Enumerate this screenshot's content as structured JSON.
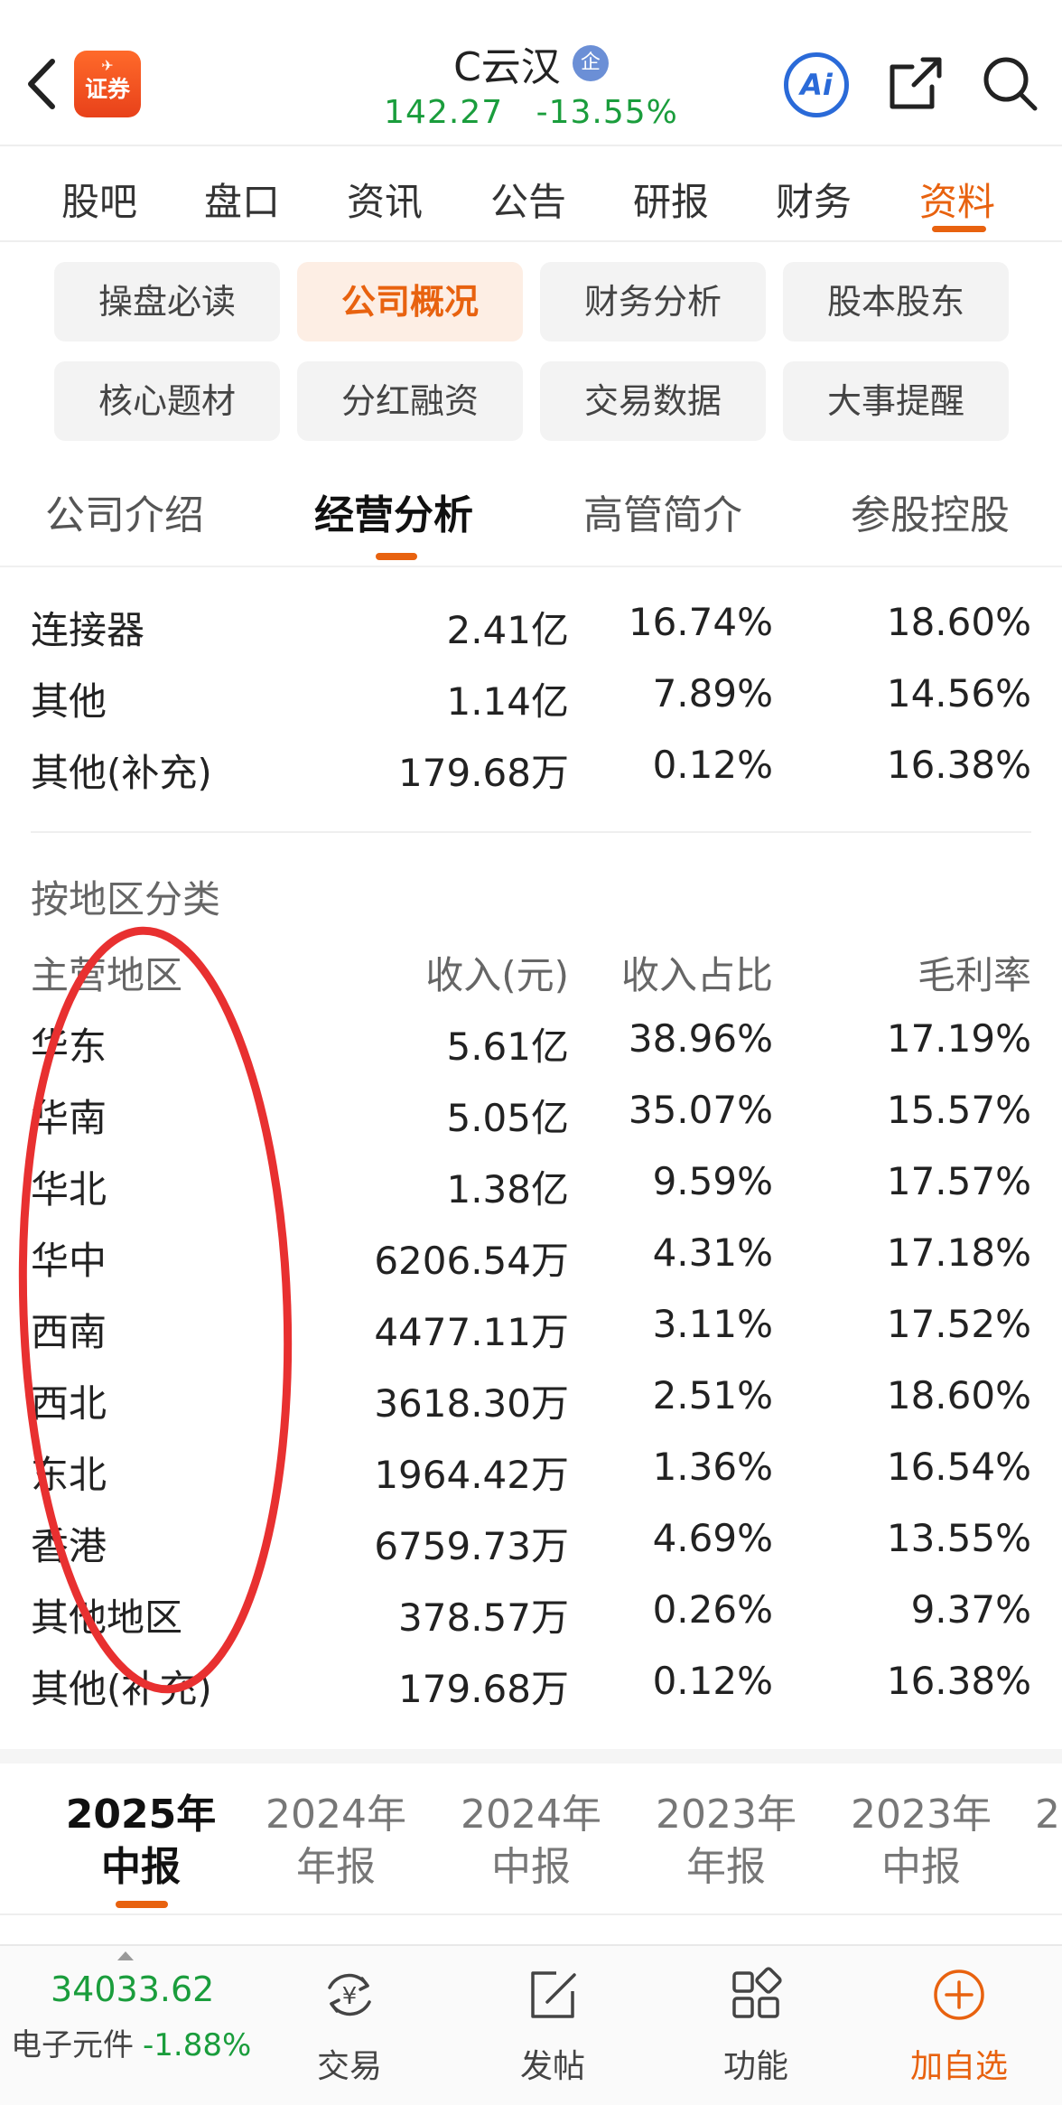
{
  "header": {
    "logo_text": "证券",
    "stock_name": "C云汉",
    "badge": "企",
    "price": "142.27",
    "change_pct": "-13.55%",
    "ai_label": "Ai"
  },
  "main_tabs": [
    "股吧",
    "盘口",
    "资讯",
    "公告",
    "研报",
    "财务",
    "资料"
  ],
  "main_tab_active": "资料",
  "chips": [
    "操盘必读",
    "公司概况",
    "财务分析",
    "股本股东",
    "核心题材",
    "分红融资",
    "交易数据",
    "大事提醒"
  ],
  "chip_active": "公司概况",
  "sub_tabs": [
    "公司介绍",
    "经营分析",
    "高管简介",
    "参股控股"
  ],
  "sub_tab_active": "经营分析",
  "product_rows": [
    [
      "连接器",
      "2.41亿",
      "16.74%",
      "18.60%"
    ],
    [
      "其他",
      "1.14亿",
      "7.89%",
      "14.56%"
    ],
    [
      "其他(补充)",
      "179.68万",
      "0.12%",
      "16.38%"
    ]
  ],
  "region_section": {
    "title": "按地区分类",
    "headers": [
      "主营地区",
      "收入(元)",
      "收入占比",
      "毛利率"
    ],
    "rows": [
      [
        "华东",
        "5.61亿",
        "38.96%",
        "17.19%"
      ],
      [
        "华南",
        "5.05亿",
        "35.07%",
        "15.57%"
      ],
      [
        "华北",
        "1.38亿",
        "9.59%",
        "17.57%"
      ],
      [
        "华中",
        "6206.54万",
        "4.31%",
        "17.18%"
      ],
      [
        "西南",
        "4477.11万",
        "3.11%",
        "17.52%"
      ],
      [
        "西北",
        "3618.30万",
        "2.51%",
        "18.60%"
      ],
      [
        "东北",
        "1964.42万",
        "1.36%",
        "16.54%"
      ],
      [
        "香港",
        "6759.73万",
        "4.69%",
        "13.55%"
      ],
      [
        "其他地区",
        "378.57万",
        "0.26%",
        "9.37%"
      ],
      [
        "其他(补充)",
        "179.68万",
        "0.12%",
        "16.38%"
      ]
    ]
  },
  "periods": [
    {
      "year": "2025年",
      "type": "中报"
    },
    {
      "year": "2024年",
      "type": "年报"
    },
    {
      "year": "2024年",
      "type": "中报"
    },
    {
      "year": "2023年",
      "type": "年报"
    },
    {
      "year": "2023年",
      "type": "中报"
    },
    {
      "year": "2",
      "type": ""
    }
  ],
  "bottom_bar": {
    "index_value": "34033.62",
    "index_name": "电子元件",
    "index_change": "-1.88%",
    "items": [
      {
        "label": "交易",
        "icon": "trade-icon"
      },
      {
        "label": "发帖",
        "icon": "post-icon"
      },
      {
        "label": "功能",
        "icon": "apps-icon"
      },
      {
        "label": "加自选",
        "icon": "add-watchlist-icon"
      }
    ]
  },
  "colors": {
    "accent": "#e8620f",
    "down_green": "#1a9d3c",
    "annotation_red": "#e83030",
    "ai_blue": "#2a6ad8"
  }
}
